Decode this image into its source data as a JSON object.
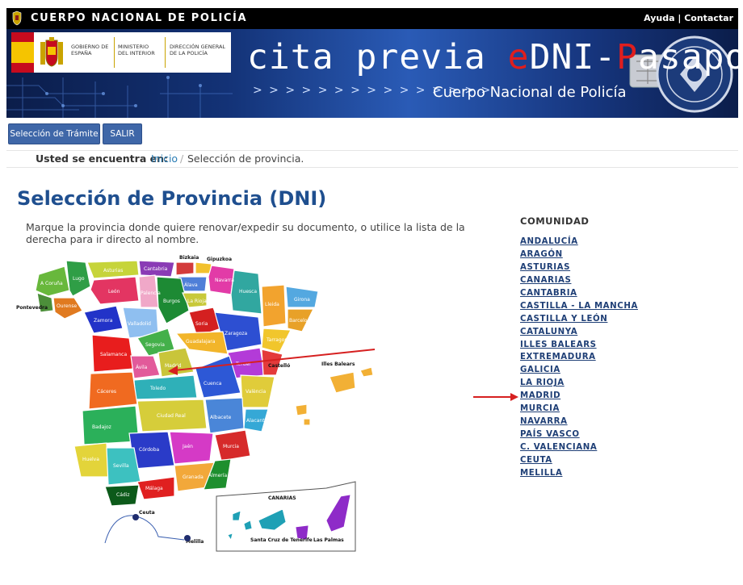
{
  "header": {
    "brand": "CUERPO NACIONAL DE POLICÍA",
    "links": [
      "Ayuda",
      "Contactar"
    ],
    "separator": "|"
  },
  "banner": {
    "gov": {
      "gobierno": "GOBIERNO DE ESPAÑA",
      "ministerio": "MINISTERIO DEL INTERIOR",
      "direccion": "DIRECCIÓN GENERAL DE LA POLICÍA"
    },
    "title_parts": [
      "cita previa ",
      "e",
      "DNI-",
      "P",
      "asaporte"
    ],
    "subtitle": "Cuerpo Nacional de Policía",
    "chevrons": "> > > > > > > > > > > > > > >",
    "badge": "CUERPO NACIONAL DE POLICÍA"
  },
  "nav": {
    "seleccion_tramite": "Selección de Trámite",
    "salir": "SALIR"
  },
  "breadcrumb": {
    "label": "Usted se encuentra en:",
    "home": "Inicio",
    "separator": "/",
    "current": "Selección de provincia."
  },
  "page": {
    "title": "Selección de Provincia (DNI)",
    "instructions": "Marque la provincia donde quiere renovar/expedir su documento, o utilice la lista de la derecha para ir directo al nombre."
  },
  "map": {
    "provinces": [
      "A Coruña",
      "Lugo",
      "Asturias",
      "Cantabria",
      "Bizkaia",
      "Gipuzkoa",
      "Navarra",
      "Huesca",
      "Lleida",
      "Girona",
      "Barcelona",
      "Tarragona",
      "Zaragoza",
      "Teruel",
      "Castelló",
      "València",
      "Alacant",
      "Murcia",
      "Almería",
      "Granada",
      "Málaga",
      "Cádiz",
      "Sevilla",
      "Huelva",
      "Badajoz",
      "Cáceres",
      "Salamanca",
      "Zamora",
      "León",
      "Palencia",
      "Burgos",
      "La Rioja",
      "Soria",
      "Segovia",
      "Valladolid",
      "Ávila",
      "Madrid",
      "Guadalajara",
      "Cuenca",
      "Toledo",
      "Ciudad Real",
      "Albacete",
      "Córdoba",
      "Jaén",
      "Ourense",
      "Pontevedra",
      "Álava"
    ],
    "outer_labels": {
      "pontevedra": "Pontevedra",
      "bizkaia": "Bizkaia",
      "gipuzkoa": "Gipuzkoa",
      "castello": "Castelló",
      "baleares": "Illes Balears",
      "ceuta": "Ceuta",
      "melilla": "Melilla",
      "canarias": "CANARIAS",
      "tenerife": "Santa Cruz de Tenerife",
      "las_palmas": "Las Palmas"
    },
    "arrow_color": "#d62020"
  },
  "comunidades": {
    "heading": "COMUNIDAD",
    "items": [
      "ANDALUCÍA",
      "ARAGÓN",
      "ASTURIAS",
      "CANARIAS",
      "CANTABRIA",
      "CASTILLA - LA MANCHA",
      "CASTILLA Y LEÓN",
      "CATALUNYA",
      "ILLES BALEARS",
      "EXTREMADURA",
      "GALICIA",
      "LA RIOJA",
      "MADRID",
      "MURCIA",
      "NAVARRA",
      "PAÍS VASCO",
      "C. VALENCIANA",
      "CEUTA",
      "MELILLA"
    ]
  },
  "colors": {
    "topbar": "#000000",
    "button": "#3f67a8",
    "title": "#1f4f8f",
    "link": "#1f3f76",
    "accent_red": "#d62020"
  }
}
